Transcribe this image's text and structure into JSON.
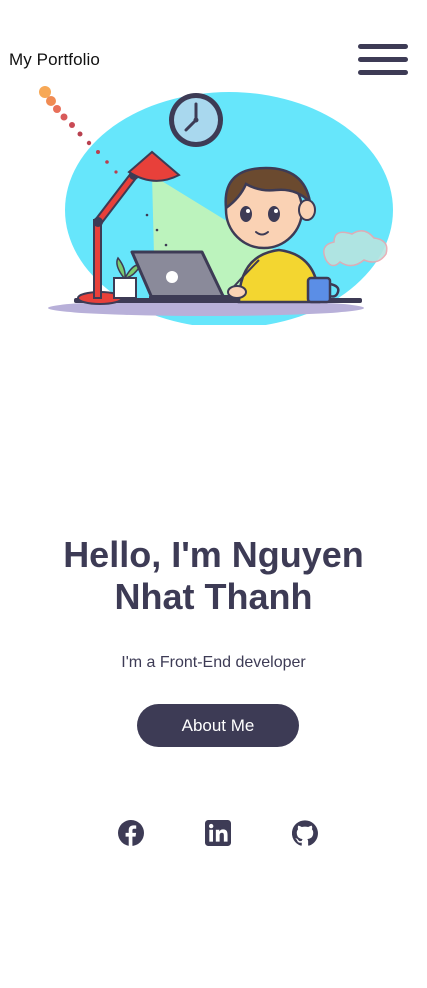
{
  "header": {
    "brand": "My Portfolio",
    "menu_icon": "hamburger-menu-icon"
  },
  "hero": {
    "illustration": "developer-working-on-laptop-illustration",
    "headline_line1": "Hello, I'm Nguyen",
    "headline_line2": "Nhat Thanh",
    "subtitle": "I'm a Front-End developer",
    "cta_label": "About Me"
  },
  "social": [
    {
      "name": "Facebook",
      "icon": "facebook-icon"
    },
    {
      "name": "LinkedIn",
      "icon": "linkedin-icon"
    },
    {
      "name": "GitHub",
      "icon": "github-icon"
    }
  ],
  "colors": {
    "primary": "#3d3b55",
    "background": "#ffffff",
    "illustration_circle": "#66e6fb",
    "lamp": "#e8403a",
    "shirt": "#f3d630"
  }
}
